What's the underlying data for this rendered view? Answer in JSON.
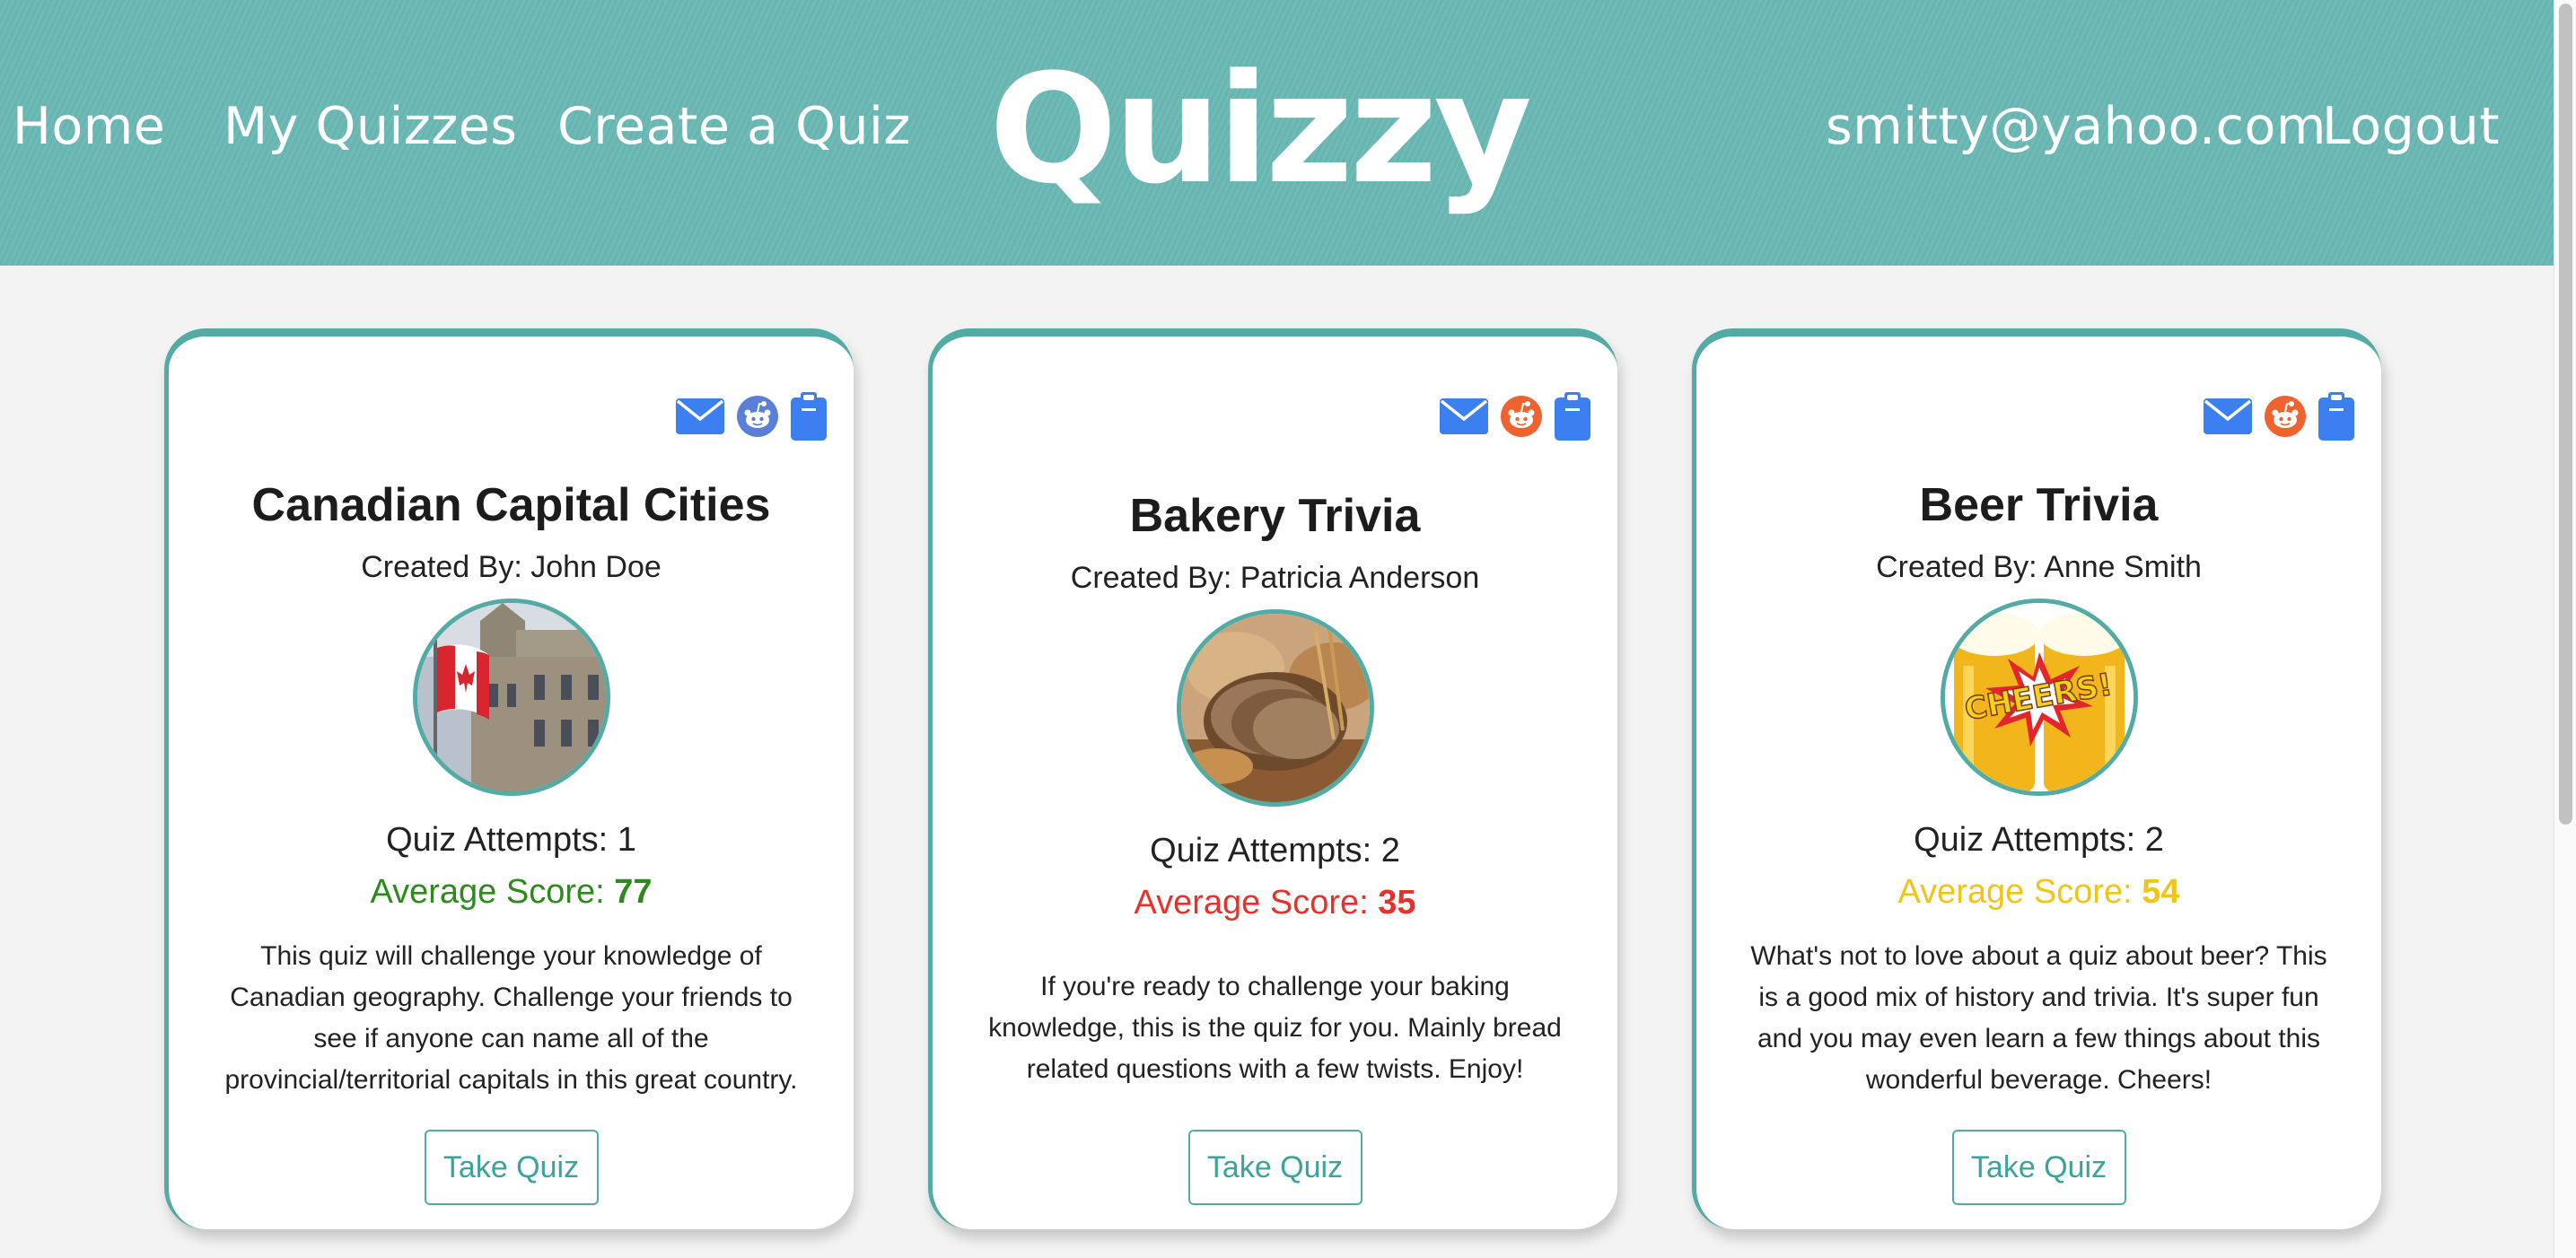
{
  "nav": {
    "home": "Home",
    "my_quizzes": "My Quizzes",
    "create": "Create a Quiz",
    "logo": "Quizzy",
    "user_email": "smitty@yahoo.com",
    "logout": "Logout"
  },
  "colors": {
    "header_bg": "#6ab8b3",
    "accent": "#52aba5",
    "score_good": "#2e8a1e",
    "score_bad": "#e5322a",
    "score_mid": "#f0c419",
    "icon_blue": "#3b7ff0",
    "reddit_orange": "#f0632e"
  },
  "quizzes": [
    {
      "title": "Canadian Capital Cities",
      "creator": "Created By: John Doe",
      "attempts": "Quiz Attempts: 1",
      "avg_label": "Average Score: ",
      "avg_value": "77",
      "score_status": "good",
      "description": "This quiz will challenge your knowledge of Canadian geography. Challenge your friends to see if anyone can name all of the provincial/territorial capitals in this great country.",
      "button": "Take Quiz",
      "image": "parliament-flag-image"
    },
    {
      "title": "Bakery Trivia",
      "creator": "Created By: Patricia Anderson",
      "attempts": "Quiz Attempts: 2",
      "avg_label": "Average Score: ",
      "avg_value": "35",
      "score_status": "bad",
      "description": "If you're ready to challenge your baking knowledge, this is the quiz for you. Mainly bread related questions with a few twists. Enjoy!",
      "button": "Take Quiz",
      "image": "bread-loaf-image"
    },
    {
      "title": "Beer Trivia",
      "creator": "Created By: Anne Smith",
      "attempts": "Quiz Attempts: 2",
      "avg_label": "Average Score: ",
      "avg_value": "54",
      "score_status": "mid",
      "description": "What's not to love about a quiz about beer? This is a good mix of history and trivia. It's super fun and you may even learn a few things about this wonderful beverage. Cheers!",
      "button": "Take Quiz",
      "image": "cheers-beer-image",
      "image_text": "CHEERS!"
    }
  ]
}
